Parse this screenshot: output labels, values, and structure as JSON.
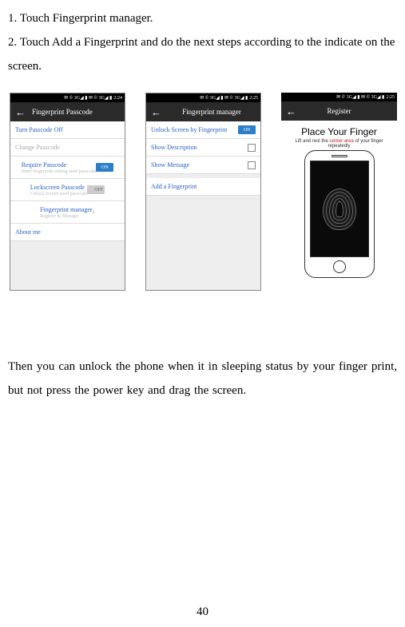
{
  "instructions": {
    "line1": "1. Touch Fingerprint manager.",
    "line2": "2. Touch Add a Fingerprint and do the next steps according to the indicate on the screen."
  },
  "screens": {
    "s1": {
      "status_time": "2:24",
      "status_icons": "✉ © 3G◢ ▮ ✉ © 3G◢ ▮",
      "title": "Fingerprint Passcode",
      "items": {
        "turn_off": "Turn Passcode Off",
        "change": "Change Passcode",
        "require": "Require Passcode",
        "require_sub": "Enter fingerprint setting need passcode",
        "lock": "Lockscreen Passcode",
        "lock_sub": "Unlock Screen need passcode",
        "manager": "Fingerprint manager",
        "manager_sub": "Register & Manager",
        "about": "About me"
      },
      "toggle_on": "ON",
      "toggle_off": "OFF"
    },
    "s2": {
      "status_time": "2:25",
      "status_icons": "✉ © 3G◢ ▮ ✉ © 3G◢ ▮",
      "title": "Fingerprint manager",
      "items": {
        "unlock": "Unlock Screen by Fingerprint",
        "desc": "Show Description",
        "msg": "Show Message",
        "add": "Add a Fingerprint"
      },
      "toggle_on": "ON"
    },
    "s3": {
      "status_time": "2:25",
      "status_icons": "✉ © 3G◢ ▮ ✉ © 3G◢ ▮",
      "title": "Register",
      "heading": "Place Your Finger",
      "hint_pre": "Lift and rest the ",
      "hint_red": "center area",
      "hint_post": " of your finger repeatedly"
    }
  },
  "paragraph2": "Then you can unlock the phone when it in sleeping status by your finger print, but not press the power key and drag the screen.",
  "page_number": "40"
}
